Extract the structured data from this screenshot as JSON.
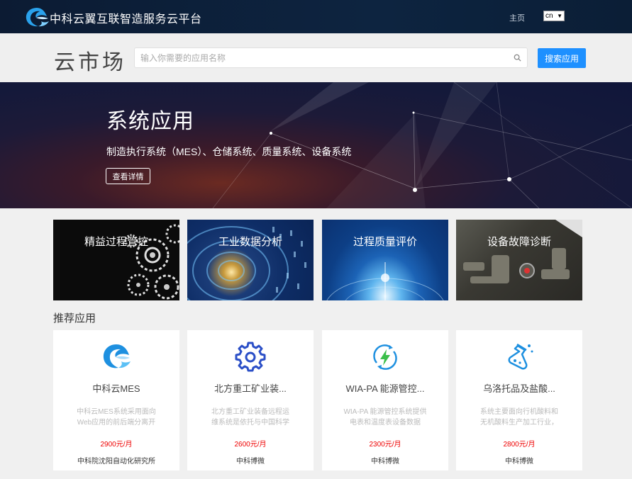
{
  "header": {
    "site_title": "中科云翼互联智造服务云平台",
    "nav_home": "主页",
    "lang_selected": "cn"
  },
  "search": {
    "market_title": "云市场",
    "placeholder": "输入你需要的应用名称",
    "button_label": "搜索应用"
  },
  "hero": {
    "title": "系统应用",
    "subtitle": "制造执行系统（MES）、仓储系统、质量系统、设备系统",
    "button_label": "查看详情"
  },
  "categories": [
    {
      "label": "精益过程管控"
    },
    {
      "label": "工业数据分析"
    },
    {
      "label": "过程质量评价"
    },
    {
      "label": "设备故障诊断"
    }
  ],
  "recommended": {
    "title": "推荐应用",
    "apps": [
      {
        "name": "中科云MES",
        "desc": "中科云MES系统采用面向Web应用的前后端分离开",
        "price": "2900元/月",
        "vendor": "中科院沈阳自动化研究所",
        "icon": "cloud-wing-logo-icon"
      },
      {
        "name": "北方重工矿业装...",
        "desc": "北方重工矿业装备远程运维系统是依托与中国科学",
        "price": "2600元/月",
        "vendor": "中科博微",
        "icon": "gear-icon"
      },
      {
        "name": "WIA-PA 能源管控...",
        "desc": "WIA-PA 能源管控系统提供电表和温度表设备数据",
        "price": "2300元/月",
        "vendor": "中科博微",
        "icon": "energy-bolt-icon"
      },
      {
        "name": "乌洛托品及盐酸...",
        "desc": "系统主要面向行机酸料和无机酸料生产加工行业，",
        "price": "2800元/月",
        "vendor": "中科博微",
        "icon": "flask-icon"
      }
    ]
  },
  "colors": {
    "accent": "#1e90ff",
    "topbar": "#0c1b33",
    "price": "#e00000"
  }
}
